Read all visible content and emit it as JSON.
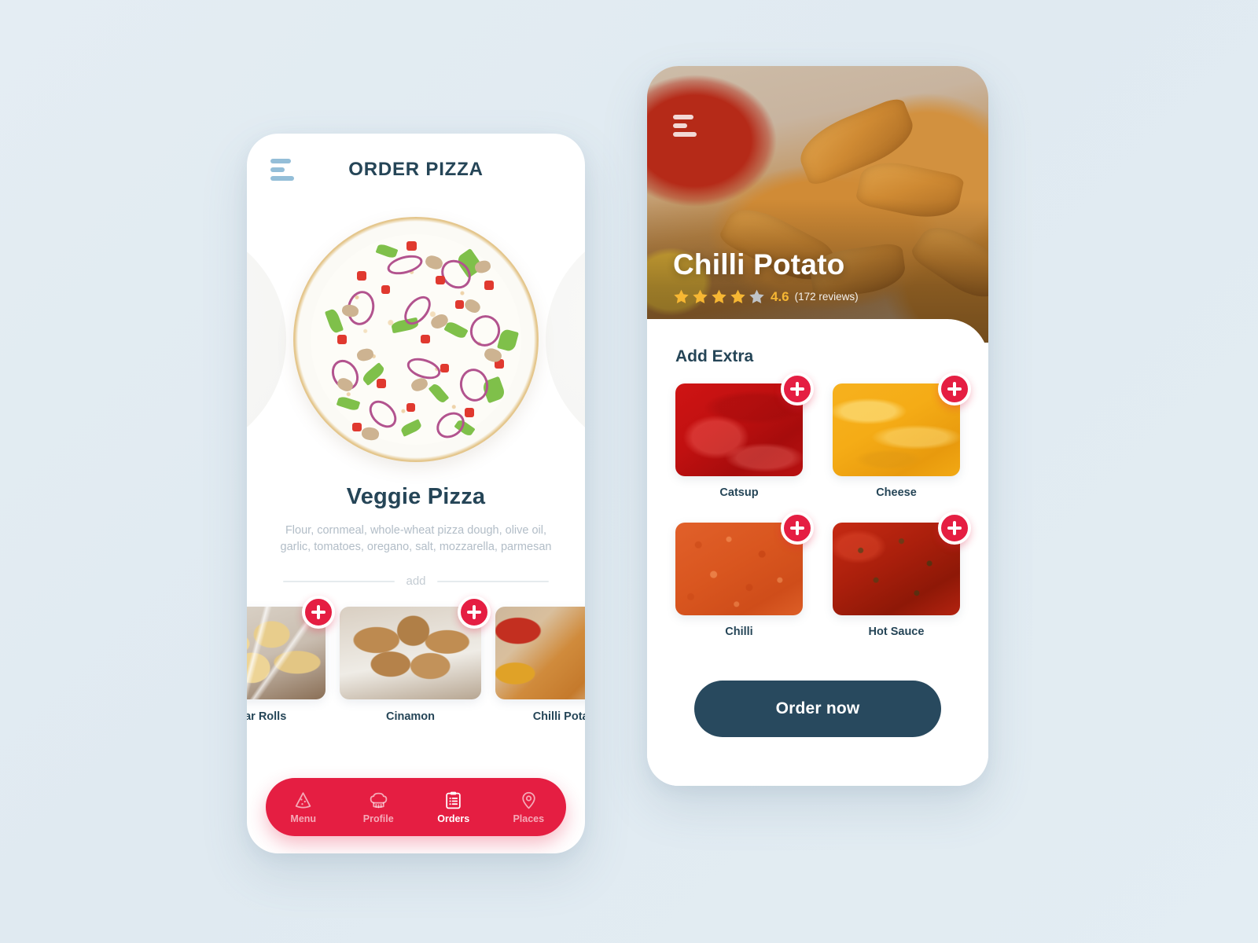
{
  "theme": {
    "background": "#e2ecf2",
    "accent_red": "#e51e42",
    "navy": "#254557",
    "button_navy": "#28495e",
    "muted_text": "#b2bdc7",
    "star_gold": "#f7b733",
    "star_gray": "#bfc3c7"
  },
  "left_screen": {
    "menu_icon": "hamburger-icon",
    "title": "ORDER PIZZA",
    "product": {
      "image": "veggie-pizza-photo",
      "name": "Veggie Pizza",
      "description": "Flour, cornmeal, whole-wheat pizza dough, olive oil, garlic, tomatoes, oregano, salt, mozzarella, parmesan"
    },
    "divider_label": "add",
    "addons": [
      {
        "label": "Sugar Rolls",
        "art": "art-sugarrolls",
        "add_icon": "plus-icon"
      },
      {
        "label": "Cinamon",
        "art": "art-cinamon",
        "add_icon": "plus-icon"
      },
      {
        "label": "Chilli Potato",
        "art": "art-chillipotato",
        "add_icon": "plus-icon"
      }
    ],
    "nav": [
      {
        "label": "Menu",
        "icon": "pizza-slice-icon",
        "active": false
      },
      {
        "label": "Profile",
        "icon": "chef-hat-icon",
        "active": false
      },
      {
        "label": "Orders",
        "icon": "clipboard-icon",
        "active": true
      },
      {
        "label": "Places",
        "icon": "location-pin-icon",
        "active": false
      }
    ]
  },
  "right_screen": {
    "menu_icon": "hamburger-icon",
    "hero_image": "chilli-potato-wedges-photo",
    "title": "Chilli Potato",
    "rating": {
      "score": "4.6",
      "stars_filled": 4,
      "stars_total": 5,
      "reviews": "(172 reviews)"
    },
    "section_heading": "Add Extra",
    "extras": [
      {
        "label": "Catsup",
        "texture": "tex-catsup",
        "add_icon": "plus-icon"
      },
      {
        "label": "Cheese",
        "texture": "tex-cheese",
        "add_icon": "plus-icon"
      },
      {
        "label": "Chilli",
        "texture": "tex-chilli",
        "add_icon": "plus-icon"
      },
      {
        "label": "Hot Sauce",
        "texture": "tex-hotsauce",
        "add_icon": "plus-icon"
      }
    ],
    "order_button": "Order now"
  }
}
